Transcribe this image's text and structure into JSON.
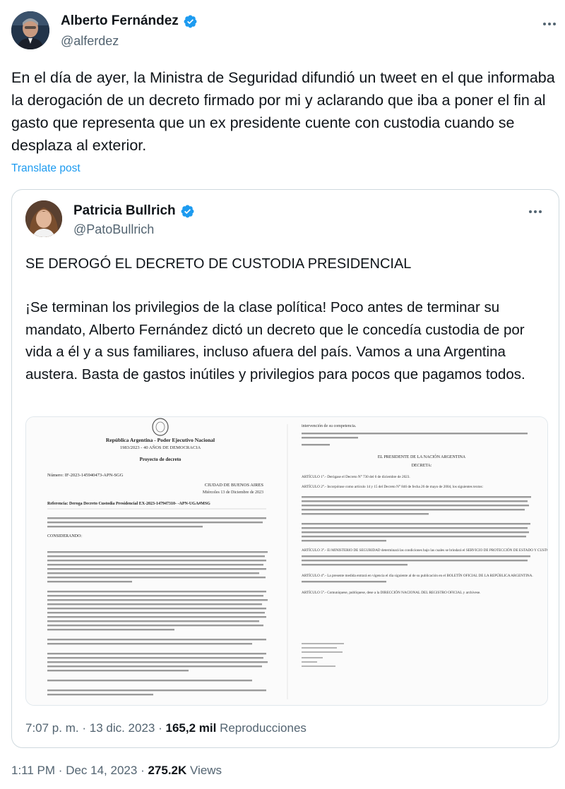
{
  "main_tweet": {
    "author_name": "Alberto Fernández",
    "handle": "@alferdez",
    "text": "En el día de ayer, la Ministra de Seguridad difundió un tweet en el que informaba la derogación de un decreto firmado por mi y aclarando que iba a poner el fin al gasto que representa que un ex presidente cuente con custodia cuando se desplaza al exterior.",
    "translate_label": "Translate post",
    "time": "1:11 PM",
    "date": "Dec 14, 2023",
    "views_count": "275.2K",
    "views_label": "Views"
  },
  "quoted_tweet": {
    "author_name": "Patricia Bullrich",
    "handle": "@PatoBullrich",
    "headline": "SE DEROGÓ EL DECRETO DE CUSTODIA PRESIDENCIAL",
    "body": "¡Se terminan los privilegios de la clase política! Poco antes de terminar su mandato, Alberto Fernández dictó un decreto que le concedía custodia de por vida a él y a sus familiares, incluso afuera del país. Vamos a una Argentina austera. Basta de gastos inútiles y privilegios para pocos que pagamos todos.",
    "time": "7:07 p. m.",
    "date": "13 dic. 2023",
    "views_count": "165,2 mil",
    "views_label": "Reproducciones",
    "document": {
      "left_page": {
        "header_line1": "República Argentina - Poder Ejecutivo Nacional",
        "header_line2": "1983/2023 - 40 AÑOS DE DEMOCRACIA",
        "doc_type": "Proyecto de decreto",
        "number": "Número: IF-2023-145940473-APN-SGG",
        "city": "CIUDAD DE BUENOS AIRES",
        "date": "Miércoles 13 de Diciembre de 2023",
        "reference": "Referencia: Deroga Decreto Custodia Presidencial EX-2023-147947310- -APN-UGA#MSG",
        "considerando": "CONSIDERANDO:"
      },
      "right_page": {
        "intro": "intervención de su competencia.",
        "president_line": "EL PRESIDENTE DE LA NACIÓN ARGENTINA",
        "decreta": "DECRETA:",
        "articles": [
          "ARTÍCULO 1°.- Derógase el Decreto N° 730 del 6 de diciembre de 2023.",
          "ARTÍCULO 2°.- Incorpórase como artículo 14 y 15 del Decreto N° 846 de fecha 26 de mayo de 2004, los siguientes textos:",
          "ARTÍCULO 3°.- El MINISTERIO DE SEGURIDAD determinará las condiciones bajo las cuales se brindará el SERVICIO DE PROTECCIÓN DE ESTADO Y CUSTODIA.",
          "ARTÍCULO 4°.- La presente medida entrará en vigencia el día siguiente al de su publicación en el BOLETÍN OFICIAL DE LA REPÚBLICA ARGENTINA.",
          "ARTÍCULO 5°.- Comuníquese, publíquese, dese a la DIRECCIÓN NACIONAL DEL REGISTRO OFICIAL y archívese."
        ]
      }
    }
  },
  "colors": {
    "text": "#0f1419",
    "secondary": "#536471",
    "link": "#1d9bf0",
    "verified": "#1d9bf0",
    "border": "#cfd9de"
  },
  "icons": {
    "verified": "verified-badge-icon",
    "more": "more-options-icon"
  }
}
